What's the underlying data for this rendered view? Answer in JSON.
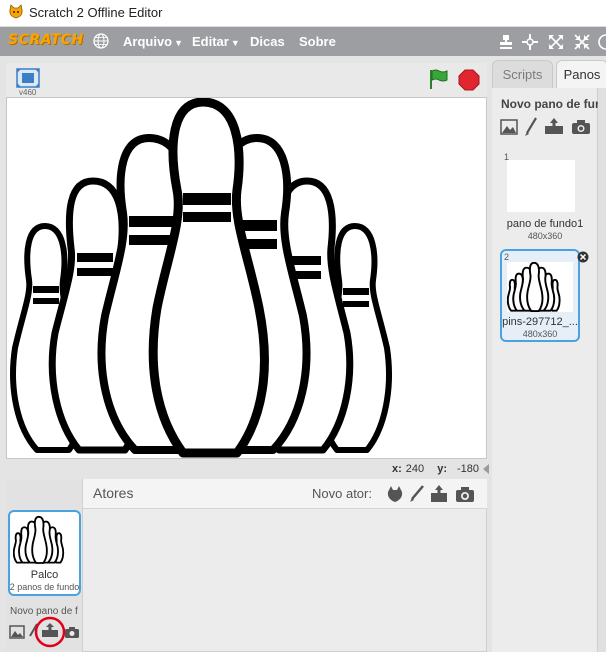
{
  "window": {
    "title": "Scratch 2 Offline Editor"
  },
  "menubar": {
    "logo": "SCRATCH",
    "items": [
      {
        "label": "Arquivo",
        "dropdown": true
      },
      {
        "label": "Editar",
        "dropdown": true
      },
      {
        "label": "Dicas",
        "dropdown": false
      },
      {
        "label": "Sobre",
        "dropdown": false
      }
    ]
  },
  "stage": {
    "version": "v460",
    "mouse_x_label": "x:",
    "mouse_x": "240",
    "mouse_y_label": "y:",
    "mouse_y": "-180"
  },
  "sprites": {
    "header": "Atores",
    "new_sprite": "Novo ator:",
    "stage_item": {
      "name": "Palco",
      "sub": "2 panos de fundo"
    },
    "new_backdrop": "Novo pano de f"
  },
  "tabs": {
    "scripts": "Scripts",
    "backdrops": "Panos"
  },
  "backdrops": {
    "new_backdrop": "Novo pano de fundo",
    "items": [
      {
        "index": "1",
        "name": "pano de fundo1",
        "size": "480x360"
      },
      {
        "index": "2",
        "name": "pins-297712_...",
        "size": "480x360"
      }
    ]
  },
  "colors": {
    "accent": "#4aa3df",
    "menubar": "#9c9ea2",
    "highlight_circle": "#e0001b"
  }
}
